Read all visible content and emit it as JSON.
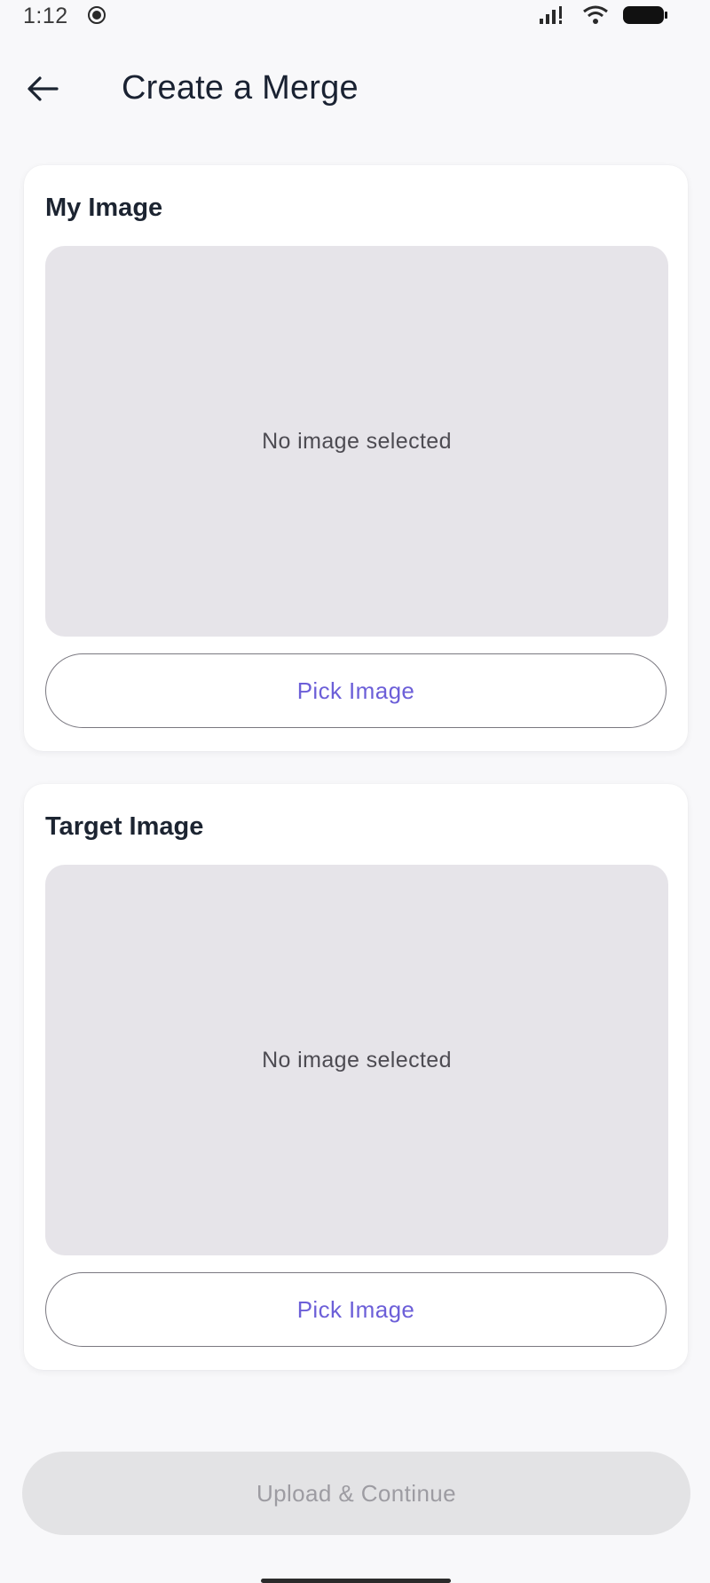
{
  "status_bar": {
    "time": "1:12",
    "icons": [
      "record-icon",
      "signal-icon",
      "wifi-icon",
      "battery-icon"
    ]
  },
  "header": {
    "title": "Create a Merge",
    "back_icon": "arrow-left-icon"
  },
  "cards": [
    {
      "title": "My Image",
      "placeholder": "No image selected",
      "button_label": "Pick Image"
    },
    {
      "title": "Target Image",
      "placeholder": "No image selected",
      "button_label": "Pick Image"
    }
  ],
  "footer": {
    "upload_label": "Upload & Continue",
    "upload_enabled": false
  },
  "colors": {
    "accent": "#6c5fd8",
    "placeholder_bg": "#e6e4e9",
    "disabled_bg": "#e3e3e5",
    "disabled_text": "#9d9ca2"
  }
}
